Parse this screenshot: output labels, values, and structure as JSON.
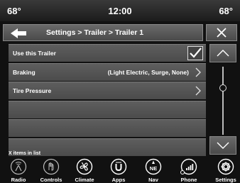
{
  "status": {
    "temp_left": "68°",
    "clock": "12:00",
    "temp_right": "68°"
  },
  "header": {
    "breadcrumb": "Settings > Trailer > Trailer 1"
  },
  "list": {
    "rows": [
      {
        "label": "Use this Trailer",
        "value": "",
        "control": "checkbox",
        "checked": true
      },
      {
        "label": "Braking",
        "value": "(Light Electric, Surge, None)",
        "control": "chevron"
      },
      {
        "label": "Tire Pressure",
        "value": "",
        "control": "chevron"
      },
      {
        "label": "",
        "value": "",
        "control": "none"
      },
      {
        "label": "",
        "value": "",
        "control": "none"
      },
      {
        "label": "",
        "value": "",
        "control": "none"
      }
    ],
    "items_note": "X items in list"
  },
  "dock": {
    "items": [
      {
        "label": "Radio",
        "icon": "radio-icon"
      },
      {
        "label": "Controls",
        "icon": "controls-icon"
      },
      {
        "label": "Climate",
        "icon": "climate-icon"
      },
      {
        "label": "Apps",
        "icon": "apps-icon"
      },
      {
        "label": "Nav",
        "icon": "compass-icon"
      },
      {
        "label": "Phone",
        "icon": "phone-icon"
      },
      {
        "label": "Settings",
        "icon": "gear-icon"
      }
    ]
  }
}
